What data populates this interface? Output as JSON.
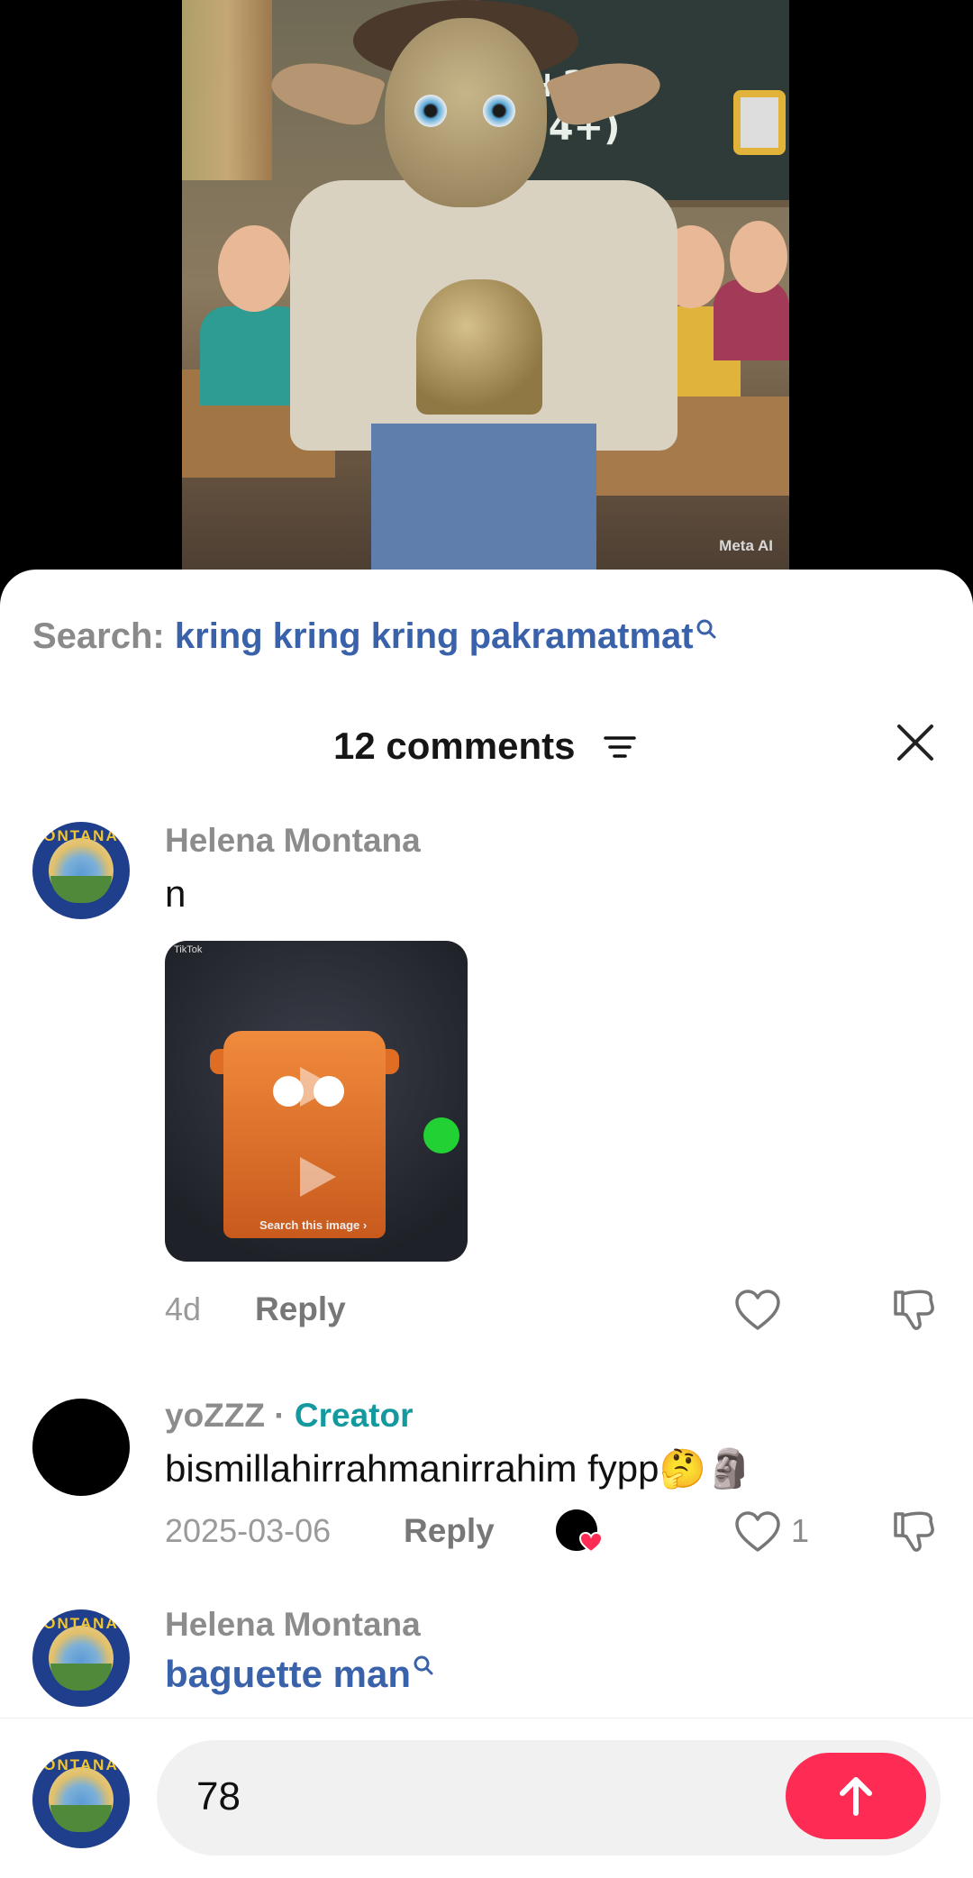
{
  "video": {
    "watermark": "Meta AI",
    "chalk_lines": "(ι+2 ι\n(=4+)"
  },
  "search": {
    "label": "Search:",
    "query": "kring kring kring pakramatmat"
  },
  "header": {
    "comments_count": "12 comments"
  },
  "comments": [
    {
      "author": "Helena Montana",
      "text": "n",
      "gif": {
        "tag": "TikTok",
        "search_label": "Search this image ›"
      },
      "time": "4d",
      "reply_label": "Reply",
      "likes": ""
    },
    {
      "author": "yoZZZ",
      "separator": "·",
      "badge": "Creator",
      "text": "bismillahirrahmanirrahim fypp🤔🗿",
      "time": "2025-03-06",
      "reply_label": "Reply",
      "likes": "1"
    },
    {
      "author": "Helena Montana",
      "text": "baguette man"
    }
  ],
  "avatar_text": "ONTANA",
  "composer": {
    "input_value": "78"
  },
  "colors": {
    "accent": "#fe2c55",
    "link": "#3a62aa",
    "creator": "#149a9e"
  }
}
